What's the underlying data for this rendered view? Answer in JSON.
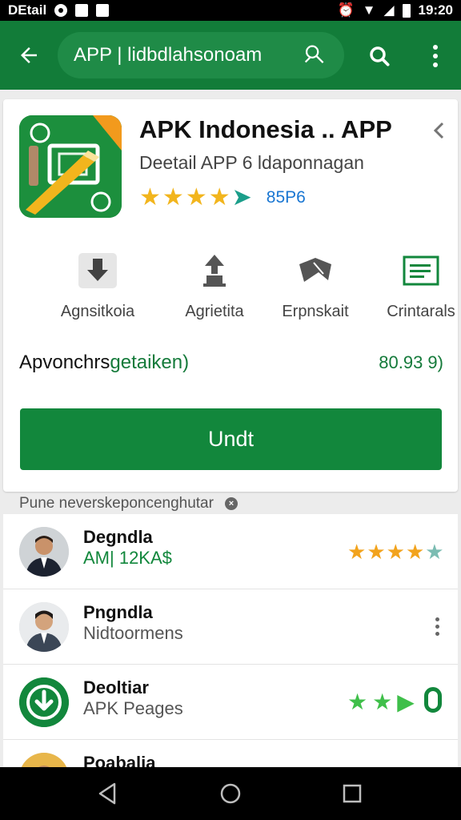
{
  "status_bar": {
    "left_text": "DEtail",
    "time": "19:20"
  },
  "toolbar": {
    "search_query": "APP | lidbdlahsonoam"
  },
  "app": {
    "title": "APK Indonesia .. APP",
    "subtitle": "Deetail APP 6 ldaponnagan",
    "rating_stars": 4.5,
    "rating_value": "85P6"
  },
  "actions": [
    {
      "label": "Agnsitkoia",
      "icon": "download-box-icon"
    },
    {
      "label": "Agrietita",
      "icon": "upload-icon"
    },
    {
      "label": "Erpnskait",
      "icon": "share-icon"
    },
    {
      "label": "Crintarals",
      "icon": "document-icon"
    }
  ],
  "size_row": {
    "label_main": "Apvonchrs",
    "label_green": "getaiken)",
    "value": "80.93 9)"
  },
  "install_button": {
    "label": "Undt"
  },
  "section": {
    "label": "Pune neverskeponcenghutar"
  },
  "list": [
    {
      "name": "Degndla",
      "sub": "AM| 12KA$",
      "sub_green": true,
      "right": "stars",
      "rating": 4.5
    },
    {
      "name": "Pngndla",
      "sub": "Nidtoormens",
      "sub_green": false,
      "right": "more"
    },
    {
      "name": "Deoltiar",
      "sub": "APK Peages",
      "sub_green": false,
      "right": "badge",
      "badge": "0"
    },
    {
      "name": "Poabalia",
      "sub": "",
      "sub_green": false,
      "right": "more"
    }
  ],
  "colors": {
    "primary": "#127c39",
    "button": "#12873c",
    "star": "#f2b51d",
    "link": "#1976d2"
  }
}
